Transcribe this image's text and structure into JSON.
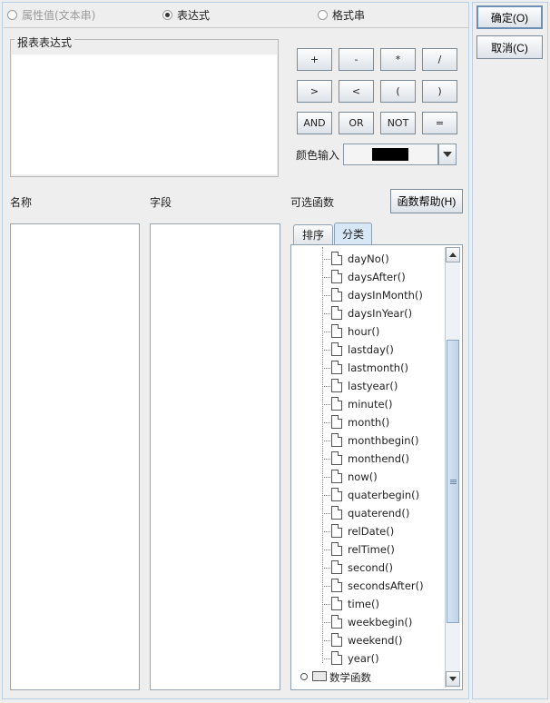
{
  "mode_options": [
    {
      "label": "属性值(文本串)",
      "selected": false,
      "disabled": true
    },
    {
      "label": "表达式",
      "selected": true,
      "disabled": false
    },
    {
      "label": "格式串",
      "selected": false,
      "disabled": false
    }
  ],
  "expression_group": {
    "title": "报表表达式",
    "value": ""
  },
  "operators": [
    "+",
    "-",
    "*",
    "/",
    ">",
    "<",
    "(",
    ")",
    "AND",
    "OR",
    "NOT",
    "="
  ],
  "color_input": {
    "label": "颜色输入",
    "value": "#000000"
  },
  "columns": {
    "name_label": "名称",
    "field_label": "字段",
    "functions_label": "可选函数"
  },
  "function_help_button": "函数帮助(H)",
  "tabs": [
    {
      "label": "排序",
      "active": false
    },
    {
      "label": "分类",
      "active": true
    }
  ],
  "function_tree": {
    "items": [
      "dayNo()",
      "daysAfter()",
      "daysInMonth()",
      "daysInYear()",
      "hour()",
      "lastday()",
      "lastmonth()",
      "lastyear()",
      "minute()",
      "month()",
      "monthbegin()",
      "monthend()",
      "now()",
      "quaterbegin()",
      "quaterend()",
      "relDate()",
      "relTime()",
      "second()",
      "secondsAfter()",
      "time()",
      "weekbegin()",
      "weekend()",
      "year()"
    ],
    "category": "数学函数"
  },
  "dialog_buttons": {
    "ok": "确定(O)",
    "cancel": "取消(C)"
  }
}
